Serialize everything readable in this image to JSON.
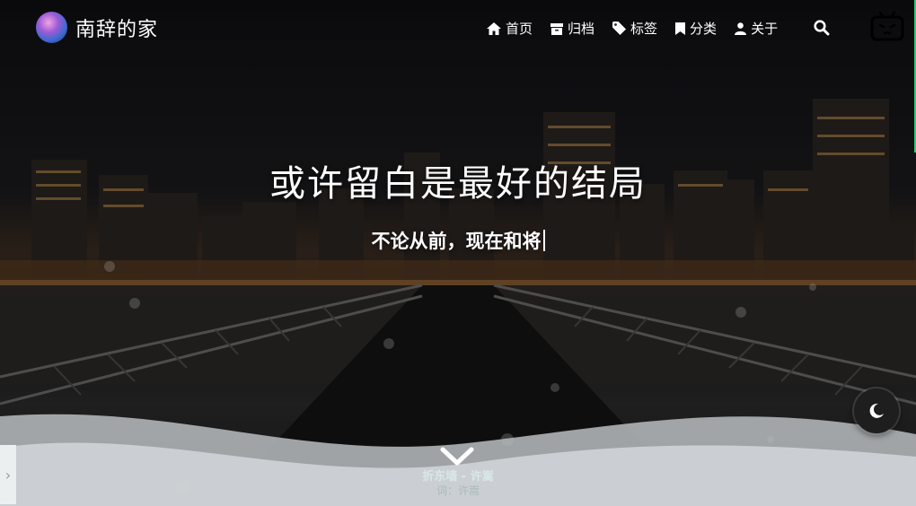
{
  "site": {
    "title": "南辞的家"
  },
  "nav": {
    "items": [
      {
        "label": "首页",
        "icon": "home-icon"
      },
      {
        "label": "归档",
        "icon": "archive-icon"
      },
      {
        "label": "标签",
        "icon": "tag-icon"
      },
      {
        "label": "分类",
        "icon": "bookmark-icon"
      },
      {
        "label": "关于",
        "icon": "user-icon"
      }
    ],
    "search_icon": "search-icon",
    "bilibili_icon": "bilibili-icon"
  },
  "hero": {
    "title": "或许留白是最好的结局",
    "subtitle": "不论从前，现在和将"
  },
  "footer": {
    "song": "折东墙 - 许嵩",
    "lyric": "词：许嵩"
  },
  "colors": {
    "accent": "#2ecc71",
    "text": "#ffffff",
    "toggle_bg": "#1e1e1e"
  }
}
